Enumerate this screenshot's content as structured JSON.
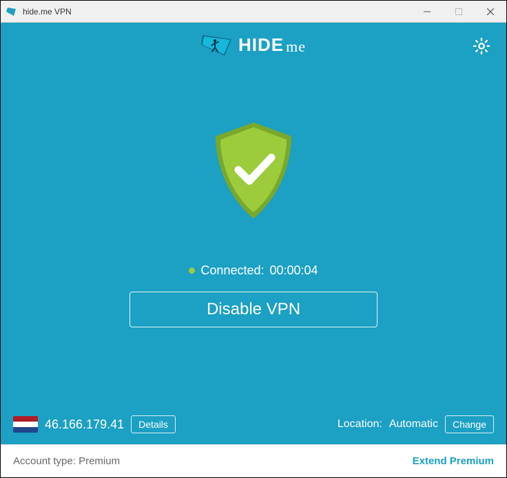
{
  "window": {
    "title": "hide.me VPN"
  },
  "brand": {
    "name": "HIDE",
    "suffix": "me"
  },
  "status": {
    "label": "Connected:",
    "duration": "00:00:04"
  },
  "main_button": {
    "label": "Disable VPN"
  },
  "ip": {
    "value": "46.166.179.41",
    "details_label": "Details"
  },
  "location": {
    "label": "Location:",
    "value": "Automatic",
    "change_label": "Change"
  },
  "footer": {
    "account_label": "Account type:",
    "account_value": "Premium",
    "extend_label": "Extend Premium"
  },
  "flag_colors": {
    "top": "#AE1C28",
    "mid": "#FFFFFF",
    "bot": "#21468B"
  },
  "accent": "#1ca0c3"
}
